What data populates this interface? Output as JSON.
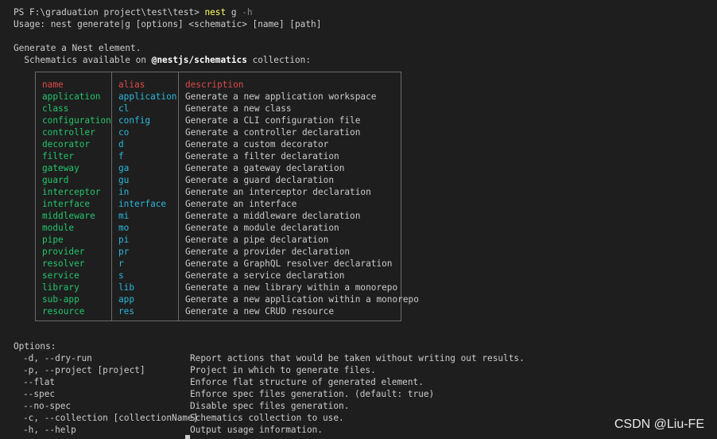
{
  "prompt": {
    "ps_path": "PS F:\\graduation project\\test\\test>",
    "command": "nest",
    "subcommand": "g",
    "flag": "-h"
  },
  "usage": "Usage: nest generate|g [options] <schematic> [name] [path]",
  "intro": {
    "line1": "Generate a Nest element.",
    "line2_prefix": "  Schematics available on ",
    "collection": "@nestjs/schematics",
    "line2_suffix": " collection:"
  },
  "table": {
    "headers": {
      "name": "name",
      "alias": "alias",
      "description": "description"
    },
    "rows": [
      {
        "name": "application",
        "alias": "application",
        "description": "Generate a new application workspace"
      },
      {
        "name": "class",
        "alias": "cl",
        "description": "Generate a new class"
      },
      {
        "name": "configuration",
        "alias": "config",
        "description": "Generate a CLI configuration file"
      },
      {
        "name": "controller",
        "alias": "co",
        "description": "Generate a controller declaration"
      },
      {
        "name": "decorator",
        "alias": "d",
        "description": "Generate a custom decorator"
      },
      {
        "name": "filter",
        "alias": "f",
        "description": "Generate a filter declaration"
      },
      {
        "name": "gateway",
        "alias": "ga",
        "description": "Generate a gateway declaration"
      },
      {
        "name": "guard",
        "alias": "gu",
        "description": "Generate a guard declaration"
      },
      {
        "name": "interceptor",
        "alias": "in",
        "description": "Generate an interceptor declaration"
      },
      {
        "name": "interface",
        "alias": "interface",
        "description": "Generate an interface"
      },
      {
        "name": "middleware",
        "alias": "mi",
        "description": "Generate a middleware declaration"
      },
      {
        "name": "module",
        "alias": "mo",
        "description": "Generate a module declaration"
      },
      {
        "name": "pipe",
        "alias": "pi",
        "description": "Generate a pipe declaration"
      },
      {
        "name": "provider",
        "alias": "pr",
        "description": "Generate a provider declaration"
      },
      {
        "name": "resolver",
        "alias": "r",
        "description": "Generate a GraphQL resolver declaration"
      },
      {
        "name": "service",
        "alias": "s",
        "description": "Generate a service declaration"
      },
      {
        "name": "library",
        "alias": "lib",
        "description": "Generate a new library within a monorepo"
      },
      {
        "name": "sub-app",
        "alias": "app",
        "description": "Generate a new application within a monorepo"
      },
      {
        "name": "resource",
        "alias": "res",
        "description": "Generate a new CRUD resource"
      }
    ]
  },
  "options": {
    "title": "Options:",
    "items": [
      {
        "flag": "-d, --dry-run",
        "description": "Report actions that would be taken without writing out results."
      },
      {
        "flag": "-p, --project [project]",
        "description": "Project in which to generate files."
      },
      {
        "flag": "--flat",
        "description": "Enforce flat structure of generated element."
      },
      {
        "flag": "--spec",
        "description": "Enforce spec files generation. (default: true)"
      },
      {
        "flag": "--no-spec",
        "description": "Disable spec files generation."
      },
      {
        "flag": "-c, --collection [collectionName]",
        "description": "Schematics collection to use."
      },
      {
        "flag": "-h, --help",
        "description": "Output usage information."
      }
    ]
  },
  "watermark": "CSDN @Liu-FE",
  "colors": {
    "background": "#1e1e1e",
    "text": "#cccccc",
    "command": "#ffff66",
    "header": "#e04a4a",
    "name_column": "#23c56c",
    "alias_column": "#29b8db",
    "border": "#6b6b6b"
  }
}
